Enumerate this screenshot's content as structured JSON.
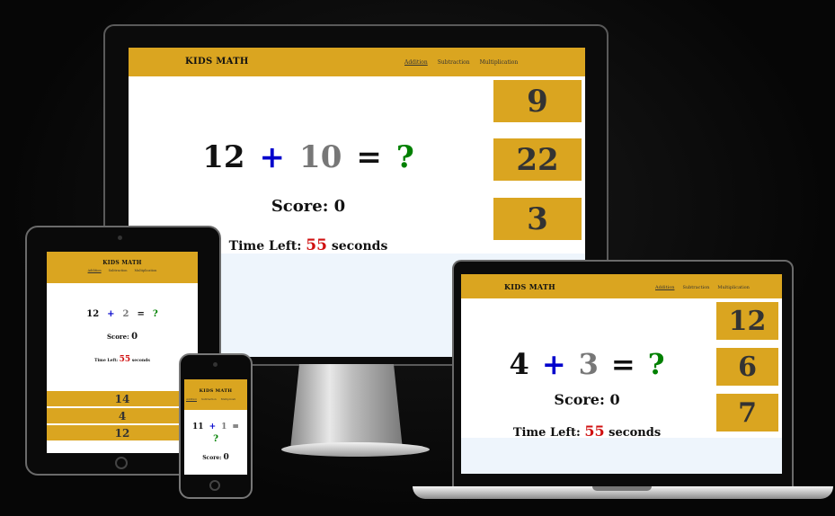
{
  "desktop": {
    "brand": "KIDS MATH",
    "nav": [
      "Addition",
      "Subtraction",
      "Multiplication"
    ],
    "equation": {
      "num1": "12",
      "op": "+",
      "num2": "10",
      "eq": "=",
      "unknown": "?"
    },
    "score_label": "Score:",
    "score": "0",
    "time_label": "Time Left:",
    "time_value": "55",
    "time_unit": "seconds",
    "answers": [
      "9",
      "22",
      "3"
    ]
  },
  "tablet": {
    "brand": "KIDS MATH",
    "nav": [
      "Addition",
      "Subtraction",
      "Multiplication"
    ],
    "equation": {
      "num1": "12",
      "op": "+",
      "num2": "2",
      "eq": "=",
      "unknown": "?"
    },
    "score_label": "Score:",
    "score": "0",
    "time_label": "Time Left:",
    "time_value": "55",
    "time_unit": "seconds",
    "answers": [
      "14",
      "4",
      "12"
    ]
  },
  "phone": {
    "brand": "KIDS MATH",
    "nav": [
      "Addition",
      "Subtraction",
      "Multiplicati"
    ],
    "equation": {
      "num1": "11",
      "op": "+",
      "num2": "1",
      "eq": "=",
      "unknown": "?"
    },
    "score_label": "Score:",
    "score": "0"
  },
  "laptop": {
    "brand": "KIDS MATH",
    "nav": [
      "Addition",
      "Subtraction",
      "Multiplication"
    ],
    "equation": {
      "num1": "4",
      "op": "+",
      "num2": "3",
      "eq": "=",
      "unknown": "?"
    },
    "score_label": "Score:",
    "score": "0",
    "time_label": "Time Left:",
    "time_value": "55",
    "time_unit": "seconds",
    "answers": [
      "12",
      "6",
      "7"
    ]
  },
  "colors": {
    "navbar": "#DAA520",
    "operator": "#0000cc",
    "unknown": "#008000",
    "timer": "#d01010"
  }
}
